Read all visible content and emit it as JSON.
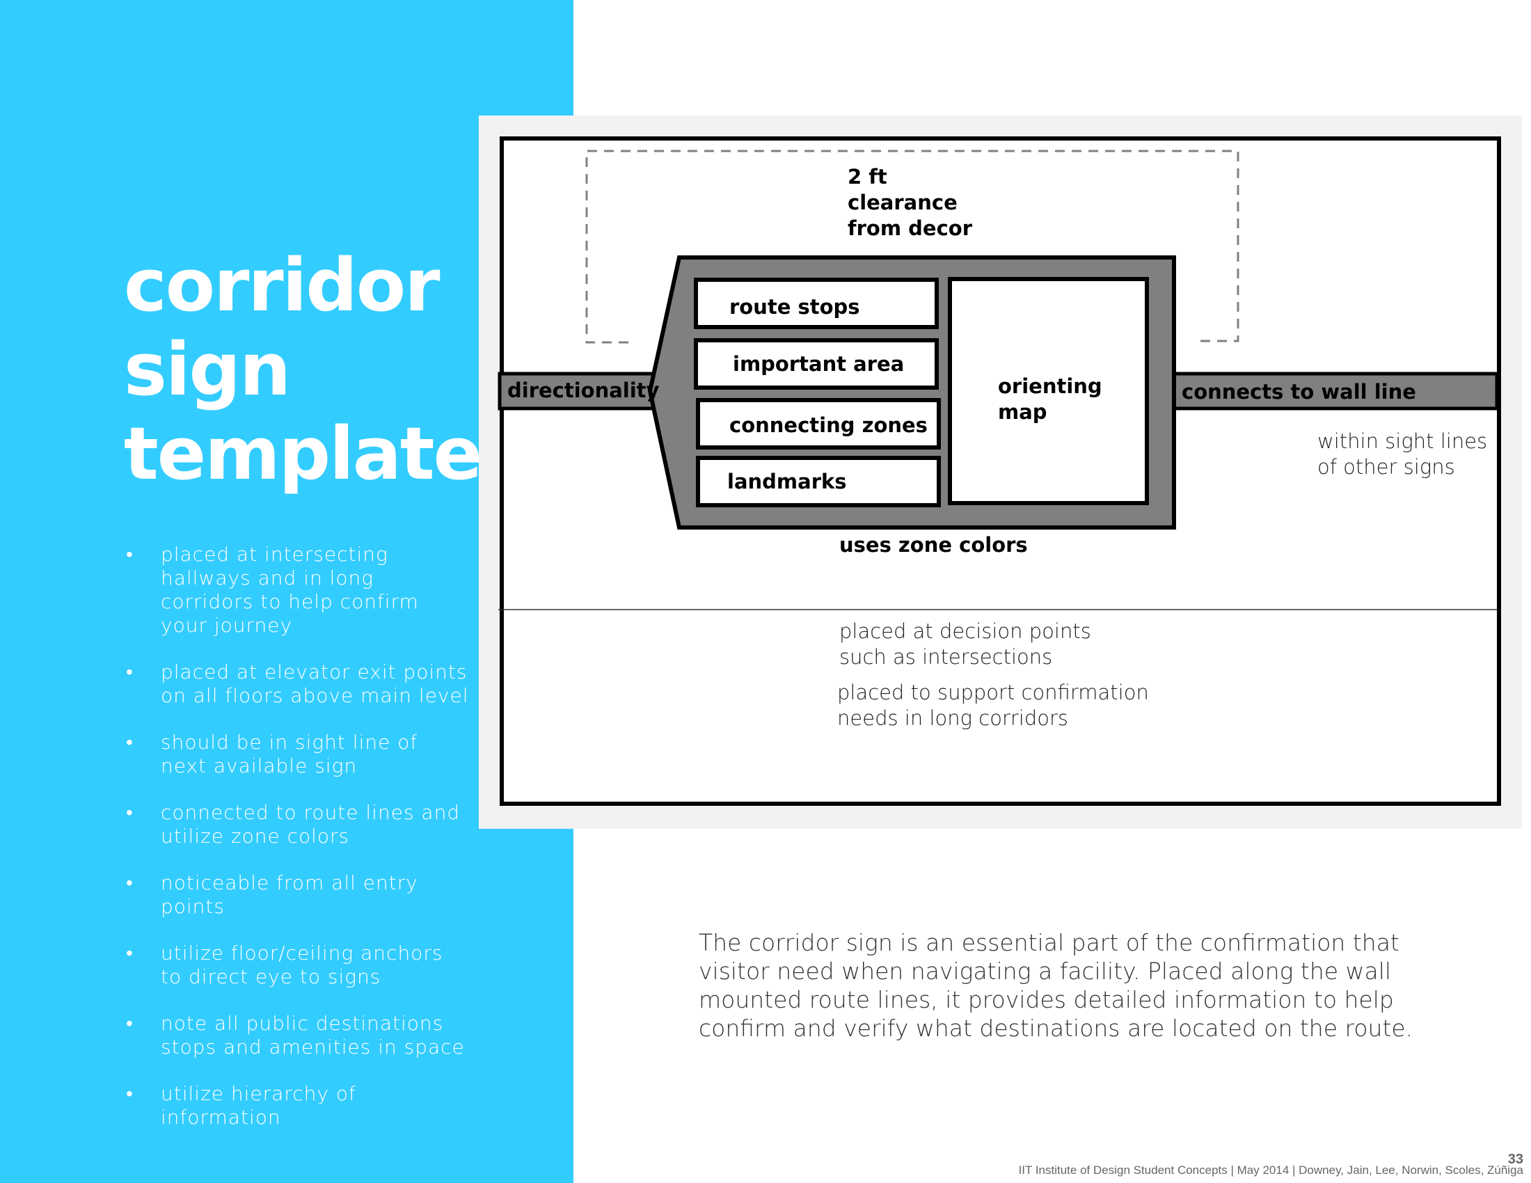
{
  "title": {
    "lines": [
      "corridor",
      "sign",
      "template"
    ]
  },
  "bullets": [
    "placed at intersecting hallways and in long corridors to help confirm your journey",
    "placed at elevator exit points on all floors above main level",
    "should be in sight line of next available sign",
    "connected to route lines and utilize zone colors",
    "noticeable from all entry points",
    "utilize floor/ceiling anchors to direct eye to signs",
    "note all public destinations stops and amenities in space",
    "utilize hierarchy of information"
  ],
  "bullet_lines": [
    [
      "placed at intersecting",
      "hallways and in long",
      "corridors to help confirm",
      "your journey"
    ],
    [
      "placed at elevator exit points",
      "on all floors above main level"
    ],
    [
      "should be in sight line of",
      "next available sign"
    ],
    [
      "connected to route lines and",
      "utilize zone colors"
    ],
    [
      "noticeable from all entry",
      "points"
    ],
    [
      "utilize floor/ceiling anchors",
      "to direct eye to signs"
    ],
    [
      "note all public destinations",
      "stops and amenities in space"
    ],
    [
      "utilize hierarchy of",
      "information"
    ]
  ],
  "bullet_glyph": "•",
  "diagram": {
    "clearance": [
      "2 ft",
      "clearance",
      "from decor"
    ],
    "directionality": "directionality",
    "wall_line": "connects to wall line",
    "panels": [
      "route stops",
      "important area",
      "connecting zones",
      "landmarks"
    ],
    "map": [
      "orienting",
      "map"
    ],
    "zone_colors": "uses zone colors",
    "sight_lines": [
      "within sight lines",
      "of other signs"
    ],
    "decision_points": [
      "placed at decision points",
      "such as intersections"
    ],
    "confirmation": [
      "placed to support confirmation",
      "needs in long corridors"
    ]
  },
  "description": [
    "The corridor sign is an essential part of the confirmation that",
    "visitor need when navigating a facility.  Placed along the wall",
    "mounted route lines, it provides detailed information to help",
    "confirm and verify what destinations are  located on the route."
  ],
  "page_number": "33",
  "footer": "IIT Institute of Design Student Concepts | May 2014 | Downey, Jain, Lee, Norwin, Scoles, Zúñiga",
  "colors": {
    "accent": "#33CCFF",
    "sign_gray": "#808080",
    "panel_bg": "#f2f2f2"
  }
}
